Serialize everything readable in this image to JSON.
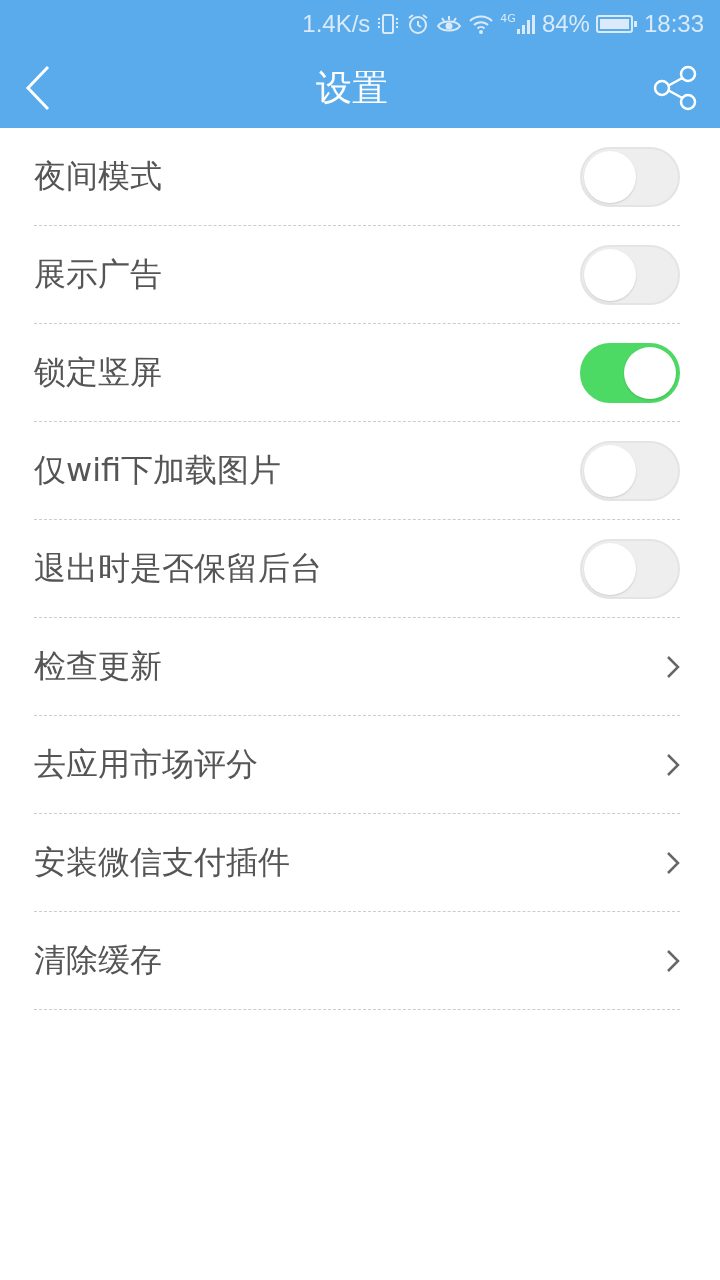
{
  "status_bar": {
    "speed": "1.4K/s",
    "network": "4G",
    "battery": "84%",
    "time": "18:33"
  },
  "toolbar": {
    "title": "设置"
  },
  "settings": [
    {
      "label": "夜间模式",
      "kind": "toggle",
      "on": false
    },
    {
      "label": "展示广告",
      "kind": "toggle",
      "on": false
    },
    {
      "label": "锁定竖屏",
      "kind": "toggle",
      "on": true
    },
    {
      "label": "仅wifi下加载图片",
      "kind": "toggle",
      "on": false
    },
    {
      "label": "退出时是否保留后台",
      "kind": "toggle",
      "on": false
    },
    {
      "label": "检查更新",
      "kind": "link"
    },
    {
      "label": "去应用市场评分",
      "kind": "link"
    },
    {
      "label": "安装微信支付插件",
      "kind": "link"
    },
    {
      "label": "清除缓存",
      "kind": "link"
    }
  ]
}
